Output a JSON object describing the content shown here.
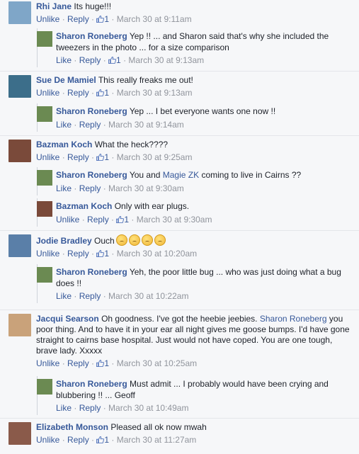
{
  "comments": [
    {
      "name": "Rhi Jane",
      "text": "Its huge!!!",
      "actions": {
        "a1": "Unlike",
        "a2": "Reply",
        "likes": "1",
        "time": "March 30 at 9:11am"
      },
      "avatar_color": "#7fa6c8",
      "replies": [
        {
          "name": "Sharon Roneberg",
          "text": "Yep !! ... and Sharon said that's why she included the tweezers in the photo ... for a size comparison",
          "actions": {
            "a1": "Like",
            "a2": "Reply",
            "likes": "1",
            "time": "March 30 at 9:13am"
          },
          "avatar_color": "#6b8a52"
        }
      ]
    },
    {
      "name": "Sue De Mamiel",
      "text": "This really freaks me out!",
      "actions": {
        "a1": "Unlike",
        "a2": "Reply",
        "likes": "1",
        "time": "March 30 at 9:13am"
      },
      "avatar_color": "#3c6e8a",
      "replies": [
        {
          "name": "Sharon Roneberg",
          "text": "Yep ... I bet everyone wants one now !!",
          "actions": {
            "a1": "Like",
            "a2": "Reply",
            "likes": "",
            "time": "March 30 at 9:14am"
          },
          "avatar_color": "#6b8a52"
        }
      ]
    },
    {
      "name": "Bazman Koch",
      "text": "What the heck????",
      "actions": {
        "a1": "Unlike",
        "a2": "Reply",
        "likes": "1",
        "time": "March 30 at 9:25am"
      },
      "avatar_color": "#7a4a3a",
      "replies": [
        {
          "name": "Sharon Roneberg",
          "text_before": "You and ",
          "mention": "Magie ZK",
          "text_after": " coming to live in Cairns ??",
          "actions": {
            "a1": "Like",
            "a2": "Reply",
            "likes": "",
            "time": "March 30 at 9:30am"
          },
          "avatar_color": "#6b8a52"
        },
        {
          "name": "Bazman Koch",
          "text": "Only with ear plugs.",
          "actions": {
            "a1": "Unlike",
            "a2": "Reply",
            "likes": "1",
            "time": "March 30 at 9:30am"
          },
          "avatar_color": "#7a4a3a"
        }
      ]
    },
    {
      "name": "Jodie Bradley",
      "text": "Ouch",
      "emoji_count": 4,
      "actions": {
        "a1": "Unlike",
        "a2": "Reply",
        "likes": "1",
        "time": "March 30 at 10:20am"
      },
      "avatar_color": "#5a7fa8",
      "replies": [
        {
          "name": "Sharon Roneberg",
          "text": "Yeh, the poor little bug ... who was just doing what a bug does !!",
          "actions": {
            "a1": "Like",
            "a2": "Reply",
            "likes": "",
            "time": "March 30 at 10:22am"
          },
          "avatar_color": "#6b8a52"
        }
      ]
    },
    {
      "name": "Jacqui Searson",
      "text_before": "Oh goodness. I've got the heebie jeebies. ",
      "mention": "Sharon Roneberg",
      "text_after": " you poor thing. And to have it in your ear all night gives me goose bumps. I'd have gone straight to cairns base hospital. Just would not have coped. You are one tough, brave lady. Xxxxx",
      "actions": {
        "a1": "Unlike",
        "a2": "Reply",
        "likes": "1",
        "time": "March 30 at 10:25am"
      },
      "avatar_color": "#c9a27a",
      "replies": [
        {
          "name": "Sharon Roneberg",
          "text": "Must admit ... I probably would have been crying and blubbering !! ... Geoff",
          "actions": {
            "a1": "Like",
            "a2": "Reply",
            "likes": "",
            "time": "March 30 at 10:49am"
          },
          "avatar_color": "#6b8a52"
        }
      ]
    },
    {
      "name": "Elizabeth Monson",
      "text": "Pleased all ok now mwah",
      "actions": {
        "a1": "Unlike",
        "a2": "Reply",
        "likes": "1",
        "time": "March 30 at 11:27am"
      },
      "avatar_color": "#8a5a4a",
      "replies": []
    }
  ],
  "icons": {
    "like": "thumbs-up-icon"
  }
}
